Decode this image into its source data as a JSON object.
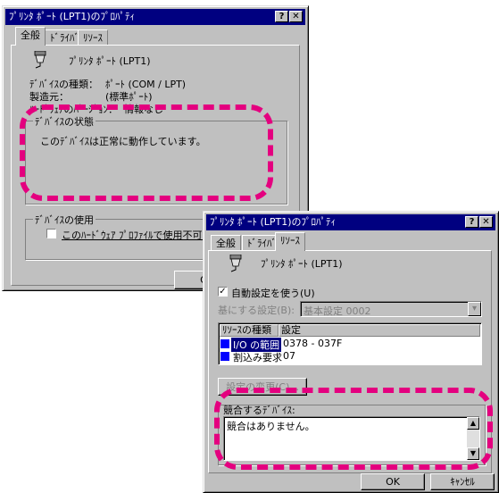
{
  "window1": {
    "title": "ﾌﾟﾘﾝﾀ ﾎﾟｰﾄ (LPT1)のﾌﾟﾛﾊﾟﾃｨ",
    "tabs": [
      "全般",
      "ﾄﾞﾗｲﾊﾞ",
      "ﾘｿｰｽ"
    ],
    "device_name": "ﾌﾟﾘﾝﾀ ﾎﾟｰﾄ (LPT1)",
    "info_labels": [
      "ﾃﾞﾊﾞｲｽの種類：",
      "製造元：",
      "ﾊｰﾄﾞｳｪｱのﾊﾞｰｼﾞｮﾝ："
    ],
    "info_values": [
      "ﾎﾟｰﾄ (COM / LPT)",
      "(標準ﾎﾟｰﾄ)",
      "情報なし"
    ],
    "status_group": "ﾃﾞﾊﾞｲｽの状態",
    "status_text": "このﾃﾞﾊﾞｲｽは正常に動作しています。",
    "usage_group": "ﾃﾞﾊﾞｲｽの使用",
    "usage_checkbox": "このﾊｰﾄﾞｳｪｱ ﾌﾟﾛﾌｧｲﾙで使用不可にす",
    "ok": "OK"
  },
  "window2": {
    "title": "ﾌﾟﾘﾝﾀ ﾎﾟｰﾄ (LPT1)のﾌﾟﾛﾊﾟﾃｨ",
    "tabs": [
      "全般",
      "ﾄﾞﾗｲﾊﾞ",
      "ﾘｿｰｽ"
    ],
    "device_name": "ﾌﾟﾘﾝﾀ ﾎﾟｰﾄ (LPT1)",
    "auto_setting": "自動設定を使う(U)",
    "base_setting_label": "基にする設定(B):",
    "base_setting_value": "基本設定 0002",
    "table_headers": [
      "ﾘｿｰｽの種類",
      "設定"
    ],
    "rows": [
      {
        "type": "I/O の範囲",
        "value": "0378 - 037F"
      },
      {
        "type": "割込み要求",
        "value": "07"
      }
    ],
    "change_button": "設定の変更(C)...",
    "conflict_label": "競合するﾃﾞﾊﾞｲｽ:",
    "conflict_text": "競合はありません。",
    "ok": "OK",
    "cancel": "ｷｬﾝｾﾙ"
  },
  "colors": {
    "highlight": "#e4007f",
    "titlebar": "#000080",
    "face": "#c0c0c0"
  }
}
